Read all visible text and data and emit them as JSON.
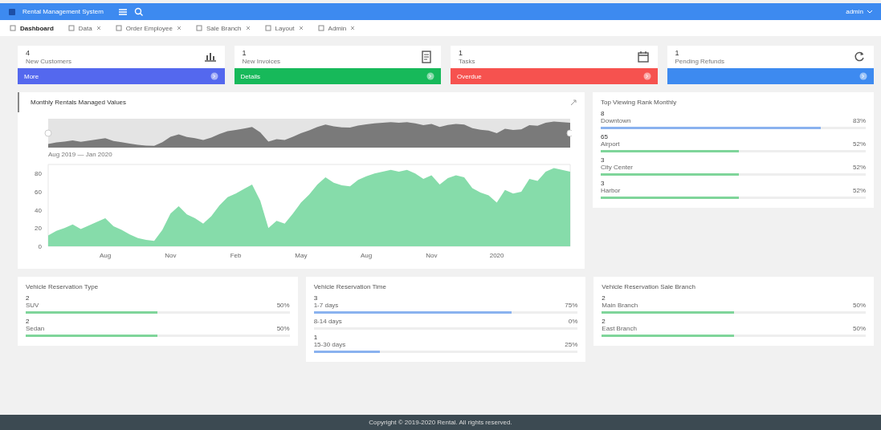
{
  "topbar": {
    "brand": "Rental Management System",
    "user": "admin"
  },
  "nav": [
    {
      "label": "Dashboard",
      "selected": true
    },
    {
      "label": "Data",
      "selected": false
    },
    {
      "label": "Order Employee",
      "selected": false
    },
    {
      "label": "Sale Branch",
      "selected": false
    },
    {
      "label": "Layout",
      "selected": false
    },
    {
      "label": "Admin",
      "selected": false
    }
  ],
  "stats": [
    {
      "value": "4",
      "label": "New Customers",
      "footer": "More",
      "color": "#5468ee"
    },
    {
      "value": "1",
      "label": "New Invoices",
      "footer": "Details",
      "color": "#17b95a"
    },
    {
      "value": "1",
      "label": "Tasks",
      "footer": "Overdue",
      "color": "#f6524f"
    },
    {
      "value": "1",
      "label": "Pending Refunds",
      "color": "#3d8af0"
    }
  ],
  "chart_card": {
    "title": "Monthly Rentals Managed Values",
    "range_label": "Aug 2019 — Jan 2020",
    "chart_data": {
      "type": "area",
      "categories": [
        null,
        null,
        null,
        null,
        null,
        null,
        null,
        "Aug",
        null,
        null,
        null,
        null,
        null,
        null,
        null,
        "Nov",
        null,
        null,
        null,
        null,
        null,
        null,
        null,
        "Feb",
        null,
        null,
        null,
        null,
        null,
        null,
        null,
        "May",
        null,
        null,
        null,
        null,
        null,
        null,
        null,
        "Aug",
        null,
        null,
        null,
        null,
        null,
        null,
        null,
        "Nov",
        null,
        null,
        null,
        null,
        null,
        null,
        null,
        "2020",
        null,
        null,
        null,
        null,
        null,
        null,
        null,
        null,
        null
      ],
      "yticks": [
        0,
        20,
        40,
        60,
        80
      ],
      "ylim": [
        0,
        90
      ],
      "series": [
        {
          "color": "#86dcaa",
          "values": [
            12,
            17,
            20,
            24,
            19,
            23,
            27,
            31,
            22,
            18,
            13,
            9,
            7,
            6,
            18,
            36,
            44,
            35,
            31,
            25,
            33,
            45,
            54,
            58,
            63,
            68,
            50,
            20,
            28,
            25,
            36,
            48,
            57,
            68,
            76,
            70,
            67,
            66,
            73,
            77,
            80,
            82,
            84,
            82,
            84,
            80,
            74,
            78,
            68,
            75,
            78,
            76,
            64,
            59,
            56,
            48,
            62,
            58,
            60,
            74,
            72,
            82,
            86,
            84,
            82
          ]
        }
      ]
    }
  },
  "rank_card": {
    "title": "Top Viewing Rank Monthly",
    "items": [
      {
        "count": "8",
        "name": "Downtown",
        "percent": "83%",
        "level": 0.83,
        "color": "#8ab2ef"
      },
      {
        "count": "65",
        "name": "Airport",
        "percent": "52%",
        "level": 0.52,
        "color": "#7fd59a"
      },
      {
        "count": "3",
        "name": "City Center",
        "percent": "52%",
        "level": 0.52,
        "color": "#7fd59a"
      },
      {
        "count": "3",
        "name": "Harbor",
        "percent": "52%",
        "level": 0.52,
        "color": "#7fd59a"
      }
    ]
  },
  "bottom_cards": [
    {
      "title": "Vehicle Reservation Type",
      "items": [
        {
          "count": "2",
          "name": "SUV",
          "percent": "50%",
          "level": 0.5,
          "color": "#7fd59a"
        },
        {
          "count": "2",
          "name": "Sedan",
          "percent": "50%",
          "level": 0.5,
          "color": "#7fd59a"
        }
      ]
    },
    {
      "title": "Vehicle Reservation Time",
      "items": [
        {
          "count": "3",
          "name": "1-7 days",
          "percent": "75%",
          "level": 0.75,
          "color": "#8ab2ef"
        },
        {
          "name": "8-14 days",
          "percent": "0%"
        },
        {
          "count": "1",
          "name": "15-30 days",
          "percent": "25%",
          "level": 0.25,
          "color": "#8ab2ef"
        }
      ]
    },
    {
      "title": "Vehicle Reservation Sale Branch",
      "items": [
        {
          "count": "2",
          "name": "Main Branch",
          "percent": "50%",
          "level": 0.5,
          "color": "#7fd59a"
        },
        {
          "count": "2",
          "name": "East Branch",
          "percent": "50%",
          "level": 0.5,
          "color": "#7fd59a"
        }
      ]
    }
  ],
  "footer": {
    "text": "Copyright © 2019-2020 Rental. All rights reserved."
  }
}
